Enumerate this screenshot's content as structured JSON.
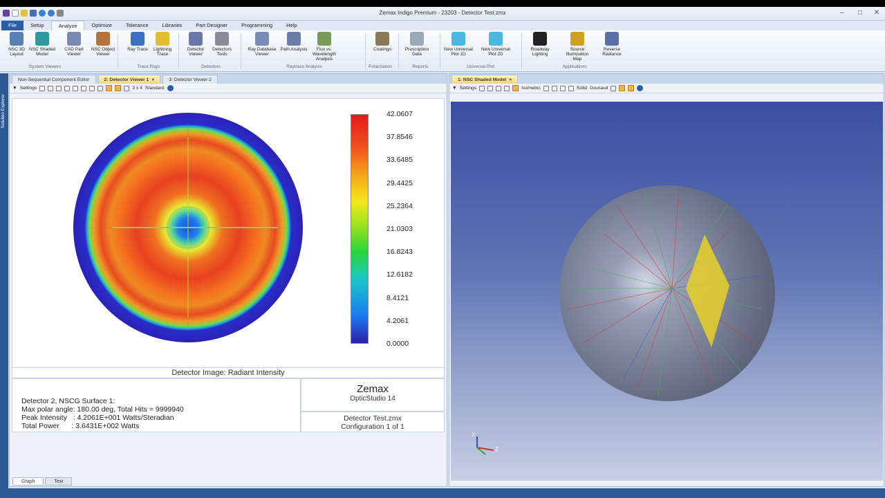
{
  "window": {
    "title": "Zemax Indigo Premium - 23203 - Detector Test.zmx"
  },
  "menu": [
    "File",
    "Setup",
    "Analyze",
    "Optimize",
    "Tolerance",
    "Libraries",
    "Part Designer",
    "Programming",
    "Help"
  ],
  "ribbon": {
    "buttons": [
      {
        "label": "NSC 3D Layout",
        "color": "#5a7fb5"
      },
      {
        "label": "NSC Shaded Model",
        "color": "#2e9aa0"
      },
      {
        "label": "CAD Part Viewer",
        "color": "#7a8ab0"
      },
      {
        "label": "NSC Object Viewer",
        "color": "#b5723a"
      },
      {
        "label": "Ray Trace",
        "color": "#3b6fc2"
      },
      {
        "label": "Lightning Trace",
        "color": "#e0c030"
      },
      {
        "label": "Detector Viewer",
        "color": "#6a78a8"
      },
      {
        "label": "Detectors Tools",
        "color": "#8a8a9a"
      },
      {
        "label": "Ray Database Viewer",
        "color": "#7b8bb8"
      },
      {
        "label": "Path Analysis",
        "color": "#6a7fa8"
      },
      {
        "label": "Flux vs. Wavelength Analysis",
        "color": "#7a9a5a"
      },
      {
        "label": "Coatings",
        "color": "#8a7a5a"
      },
      {
        "label": "Prescription Data",
        "color": "#9aa8b8"
      },
      {
        "label": "New Universal Plot 1D",
        "color": "#4ab8e0"
      },
      {
        "label": "New Universal Plot 2D",
        "color": "#4ab8e0"
      },
      {
        "label": "Roadway Lighting",
        "color": "#222222"
      },
      {
        "label": "Source Illumination Map",
        "color": "#d0a020"
      },
      {
        "label": "Reverse Radiance",
        "color": "#5a6fa8"
      }
    ],
    "groups": [
      "System Viewers",
      "Trace Rays",
      "Detectors",
      "Raytrace Analysis",
      "Polarization",
      "Reports",
      "Universal Plot",
      "Applications"
    ]
  },
  "left_strip_label": "Solution Explorer",
  "left_panel": {
    "tabs": [
      "Non-Sequential Component Editor",
      "2: Detector Viewer 1",
      "3: Detector Viewer 2"
    ],
    "toolbar": {
      "settings": "Settings",
      "layout": "3 x 4",
      "scheme": "Standard"
    },
    "chart_data": {
      "type": "heatmap",
      "title": "Detector Image: Radiant Intensity",
      "colorbar_ticks": [
        "42.0607",
        "37.8546",
        "33.6485",
        "29.4425",
        "25.2364",
        "21.0303",
        "16.8243",
        "12.6182",
        "8.4121",
        "4.2061",
        "0.0000"
      ],
      "colorbar_range": [
        0,
        42.0607
      ],
      "projection": "polar",
      "center_value_level": "low",
      "ring_value_level": "high",
      "edge_value_level": "low"
    },
    "caption": "Detector Image: Radiant Intensity",
    "info": {
      "line1": "Detector 2, NSCG Surface 1:",
      "line2": "Max polar angle: 180.00 deg, Total Hits = 9999940",
      "line3": "Peak Intensity   : 4.2061E+001 Watts/Steradian",
      "line4": "Total Power      : 3.6431E+002 Watts"
    },
    "brand": {
      "name": "Zemax",
      "product": "OpticStudio 14"
    },
    "file": {
      "name": "Detector Test.zmx",
      "config": "Configuration 1 of 1"
    },
    "bottom_tabs": [
      "Graph",
      "Text"
    ]
  },
  "right_panel": {
    "tab": "1: NSC Shaded Model",
    "toolbar": {
      "settings": "Settings",
      "view": "Isometric",
      "render": "Solid",
      "shading": "Gouraud"
    },
    "axis_labels": {
      "x": "X",
      "y": "Y",
      "z": "Z"
    }
  }
}
